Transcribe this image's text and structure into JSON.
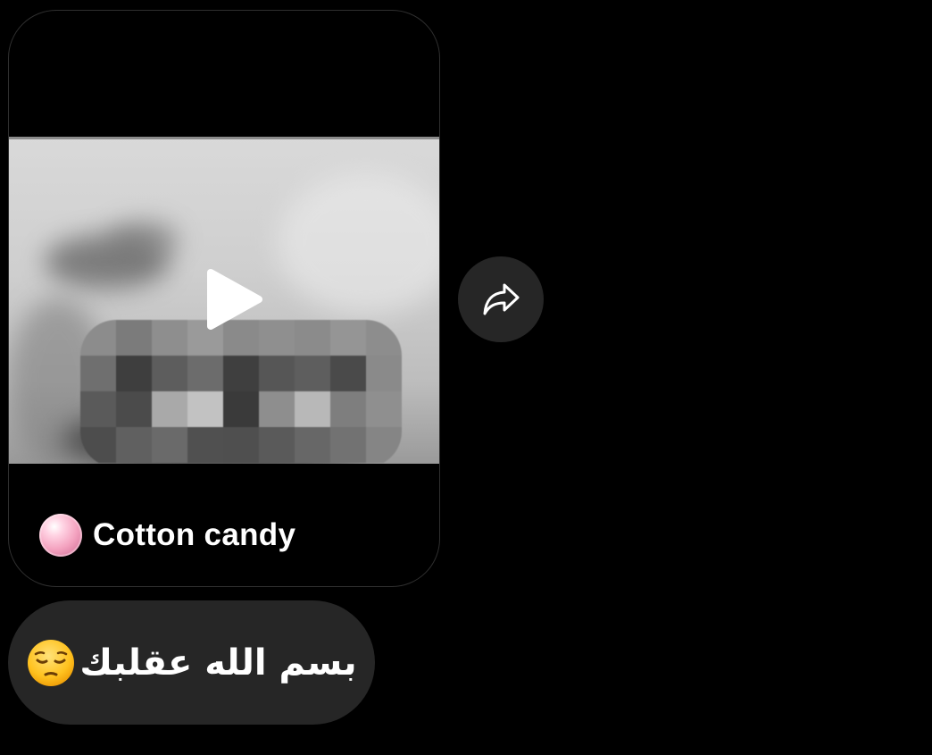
{
  "reel": {
    "author_name": "Cotton candy",
    "media_type": "video",
    "play_icon": "play-icon",
    "avatar_icon": "pink-bubble-avatar"
  },
  "share": {
    "icon": "share-arrow-icon"
  },
  "message": {
    "text": "بسم الله عقلبك",
    "emoji": "pensive-face-emoji"
  },
  "colors": {
    "background": "#000000",
    "bubble": "#262626",
    "card_border": "#2f2f2f",
    "text": "#ffffff"
  }
}
